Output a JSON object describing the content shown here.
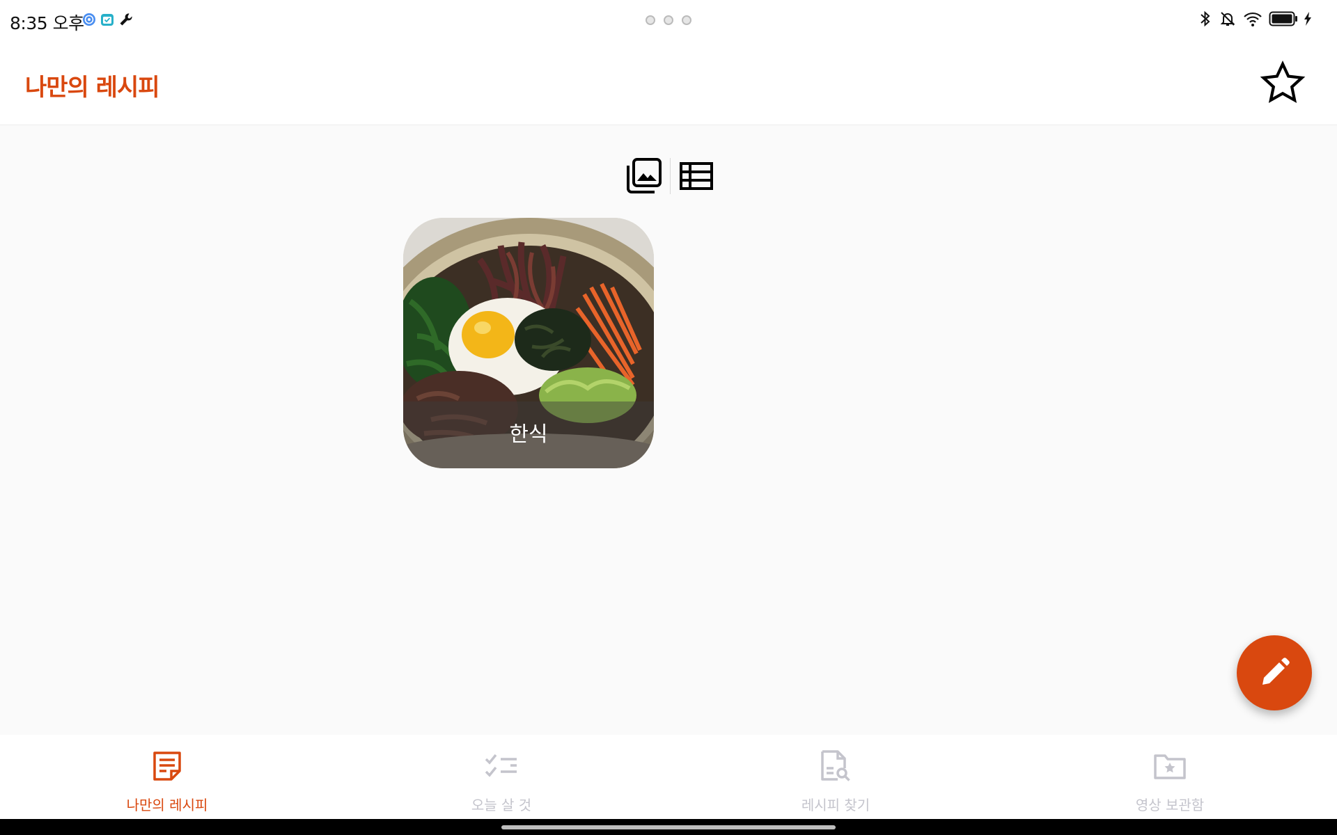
{
  "status_bar": {
    "time": "8:35 오후",
    "app_icons": [
      "target-app-icon",
      "calendar-app-icon",
      "wrench-icon"
    ],
    "indicators": [
      "bluetooth-icon",
      "notifications-off-icon",
      "wifi-icon",
      "battery-icon",
      "charging-icon"
    ]
  },
  "app_bar": {
    "title": "나만의 레시피",
    "favorite_icon": "star-outline-icon"
  },
  "view_toggle": {
    "options": [
      "gallery-view-icon",
      "list-view-icon"
    ],
    "selected": "gallery"
  },
  "categories": [
    {
      "label": "한식",
      "image": "bibimbap-photo"
    }
  ],
  "fab": {
    "icon": "pencil-icon"
  },
  "bottom_nav": {
    "items": [
      {
        "label": "나만의 레시피",
        "icon": "recipe-note-icon",
        "active": true
      },
      {
        "label": "오늘 살 것",
        "icon": "checklist-icon",
        "active": false
      },
      {
        "label": "레시피 찾기",
        "icon": "document-search-icon",
        "active": false
      },
      {
        "label": "영상 보관함",
        "icon": "star-folder-icon",
        "active": false
      }
    ]
  },
  "colors": {
    "accent": "#d9480f",
    "background": "#fafafa",
    "inactive": "#c4c4cc"
  }
}
